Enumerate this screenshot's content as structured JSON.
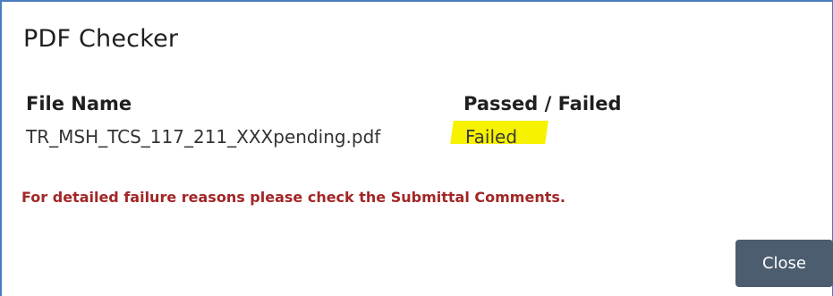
{
  "dialog": {
    "title": "PDF Checker",
    "table": {
      "headers": [
        "File Name",
        "Passed / Failed"
      ],
      "rows": [
        {
          "file_name": "TR_MSH_TCS_117_211_XXXpending.pdf",
          "status": "Failed"
        }
      ]
    },
    "message": "For detailed failure reasons please check the Submittal Comments.",
    "close_label": "Close",
    "colors": {
      "border": "#4a7cc0",
      "message": "#a32626",
      "highlight": "#f6f200",
      "button": "#4c5d70"
    }
  }
}
